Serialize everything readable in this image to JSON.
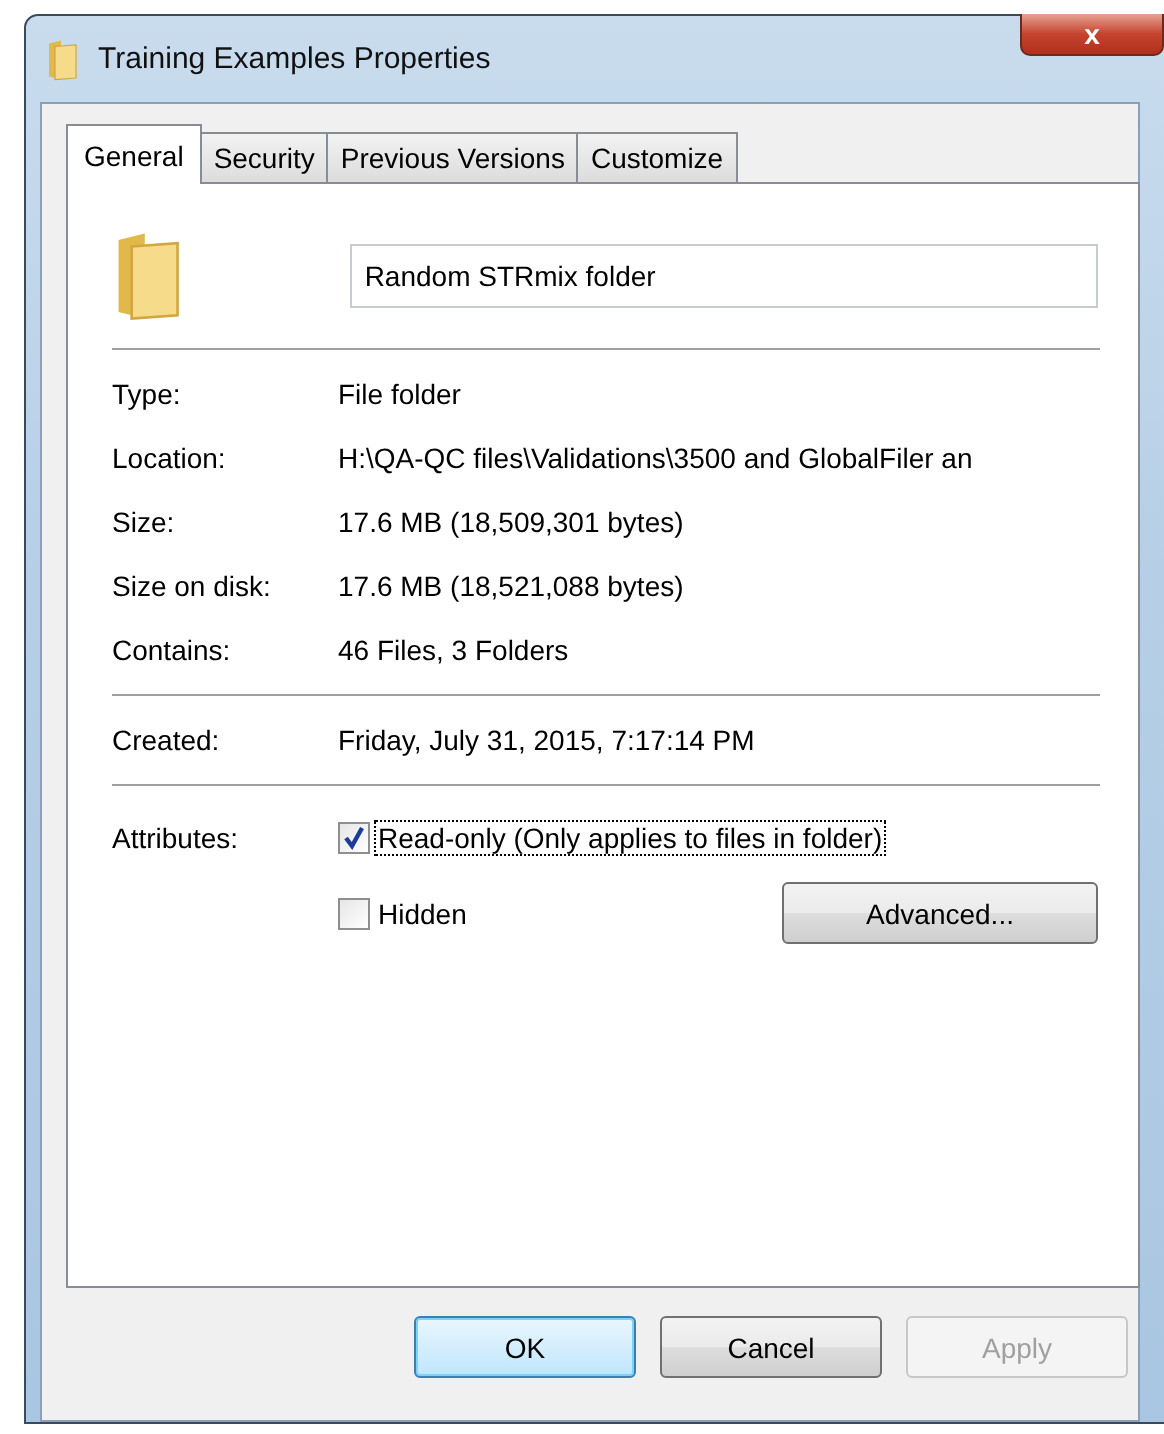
{
  "window": {
    "title": "Training Examples Properties",
    "close": "x"
  },
  "tabs": [
    {
      "label": "General",
      "selected": true
    },
    {
      "label": "Security",
      "selected": false
    },
    {
      "label": "Previous Versions",
      "selected": false
    },
    {
      "label": "Customize",
      "selected": false
    }
  ],
  "name_field": {
    "value": "Random STRmix folder"
  },
  "properties": [
    {
      "label": "Type:",
      "value": "File folder"
    },
    {
      "label": "Location:",
      "value": "H:\\QA-QC files\\Validations\\3500 and GlobalFiler an"
    },
    {
      "label": "Size:",
      "value": "17.6 MB (18,509,301 bytes)"
    },
    {
      "label": "Size on disk:",
      "value": "17.6 MB (18,521,088 bytes)"
    },
    {
      "label": "Contains:",
      "value": "46 Files, 3 Folders"
    }
  ],
  "dates": [
    {
      "label": "Created:",
      "value": "Friday, July 31, 2015, 7:17:14 PM"
    }
  ],
  "attributes": {
    "label": "Attributes:",
    "checkboxes": [
      {
        "label": "Read-only (Only applies to files in folder)",
        "checked": true,
        "focused": true
      },
      {
        "label": "Hidden",
        "checked": false,
        "focused": false
      }
    ],
    "advanced_button": "Advanced..."
  },
  "buttons": [
    {
      "label": "OK",
      "default": true,
      "disabled": false
    },
    {
      "label": "Cancel",
      "default": false,
      "disabled": false
    },
    {
      "label": "Apply",
      "default": false,
      "disabled": true
    }
  ]
}
